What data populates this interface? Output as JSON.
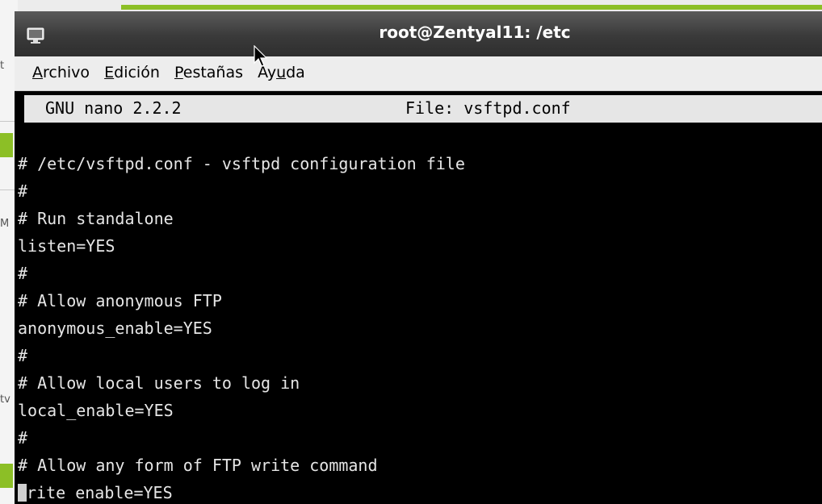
{
  "window": {
    "title": "root@Zentyal11: /etc"
  },
  "menubar": {
    "items": [
      {
        "mnemonic": "A",
        "rest": "rchivo"
      },
      {
        "mnemonic": "E",
        "rest": "dición"
      },
      {
        "mnemonic": "P",
        "rest": "estañas"
      },
      {
        "pre": "Ay",
        "mnemonic": "u",
        "rest": "da"
      }
    ]
  },
  "nano": {
    "version": "GNU nano 2.2.2",
    "file": "File: vsftpd.conf"
  },
  "editor": {
    "lines": [
      "# /etc/vsftpd.conf - vsftpd configuration file",
      "#",
      "# Run standalone",
      "listen=YES",
      "#",
      "# Allow anonymous FTP",
      "anonymous_enable=YES",
      "#",
      "# Allow local users to log in",
      "local_enable=YES",
      "#",
      "# Allow any form of FTP write command"
    ],
    "last_line_rest": "rite enable=YES"
  },
  "background": {
    "fragments": [
      "t",
      "M",
      "tv"
    ]
  },
  "colors": {
    "accent_green": "#8cbf26",
    "terminal_bg": "#000000",
    "terminal_fg": "#e6e6e6"
  }
}
